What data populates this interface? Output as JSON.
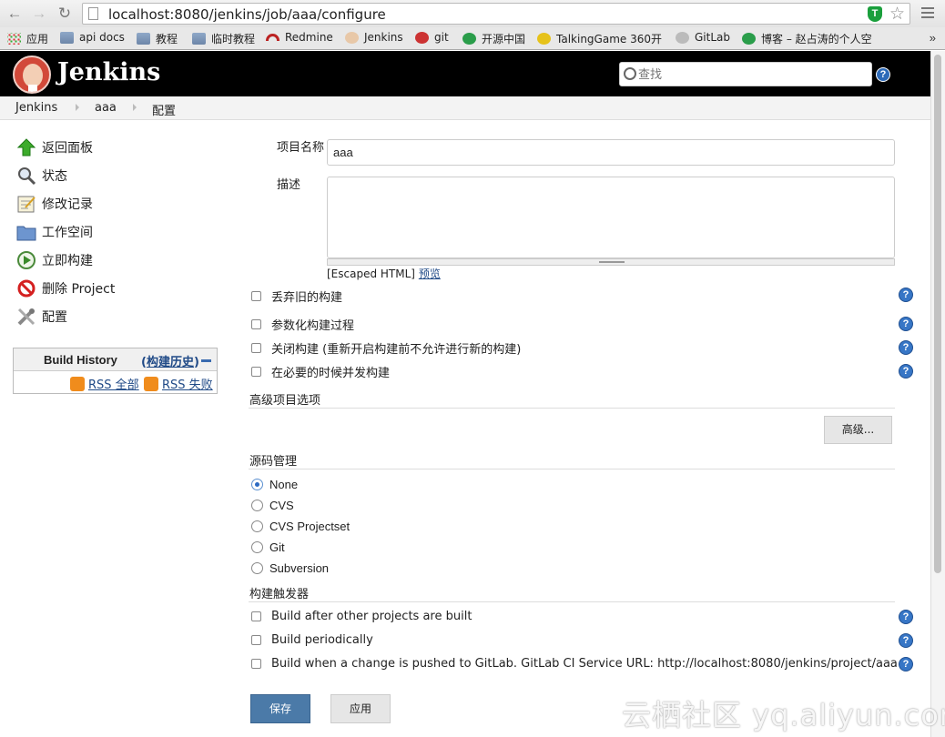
{
  "browser": {
    "url": "localhost:8080/jenkins/job/aaa/configure",
    "bookmarks": [
      "应用",
      "api docs",
      "教程",
      "临时教程",
      "Redmine",
      "Jenkins",
      "git",
      "开源中国",
      "TalkingGame 360开",
      "GitLab",
      "博客 – 赵占涛的个人空"
    ],
    "more": "»"
  },
  "header": {
    "title": "Jenkins",
    "search_placeholder": "查找",
    "help": "?"
  },
  "breadcrumbs": [
    "Jenkins",
    "aaa",
    "配置"
  ],
  "sidebar": {
    "tasks": [
      "返回面板",
      "状态",
      "修改记录",
      "工作空间",
      "立即构建",
      "删除 Project",
      "配置"
    ],
    "build_history": {
      "title": "Build History",
      "link": "构建历史",
      "rss_all": "RSS 全部",
      "rss_fail": "RSS 失败"
    }
  },
  "form": {
    "project_name_label": "项目名称",
    "project_name_value": "aaa",
    "description_label": "描述",
    "escaped_prefix": "[Escaped HTML]",
    "preview_link": "预览",
    "options": [
      "丢弃旧的构建",
      "参数化构建过程",
      "关闭构建 (重新开启构建前不允许进行新的构建)",
      "在必要的时候并发构建"
    ],
    "advanced_section": "高级项目选项",
    "advanced_button": "高级...",
    "scm_section": "源码管理",
    "scm_options": [
      "None",
      "CVS",
      "CVS Projectset",
      "Git",
      "Subversion"
    ],
    "scm_selected": "None",
    "triggers_section": "构建触发器",
    "triggers": [
      "Build after other projects are built",
      "Build periodically",
      "Build when a change is pushed to GitLab. GitLab CI Service URL: http://localhost:8080/jenkins/project/aaa"
    ],
    "save": "保存",
    "apply": "应用"
  },
  "watermark": "云栖社区 yq.aliyun.com",
  "colors": {
    "header_bg": "#000000",
    "save_button": "#4b7aa8",
    "help_icon": "#3776c6",
    "link": "#204a87"
  }
}
